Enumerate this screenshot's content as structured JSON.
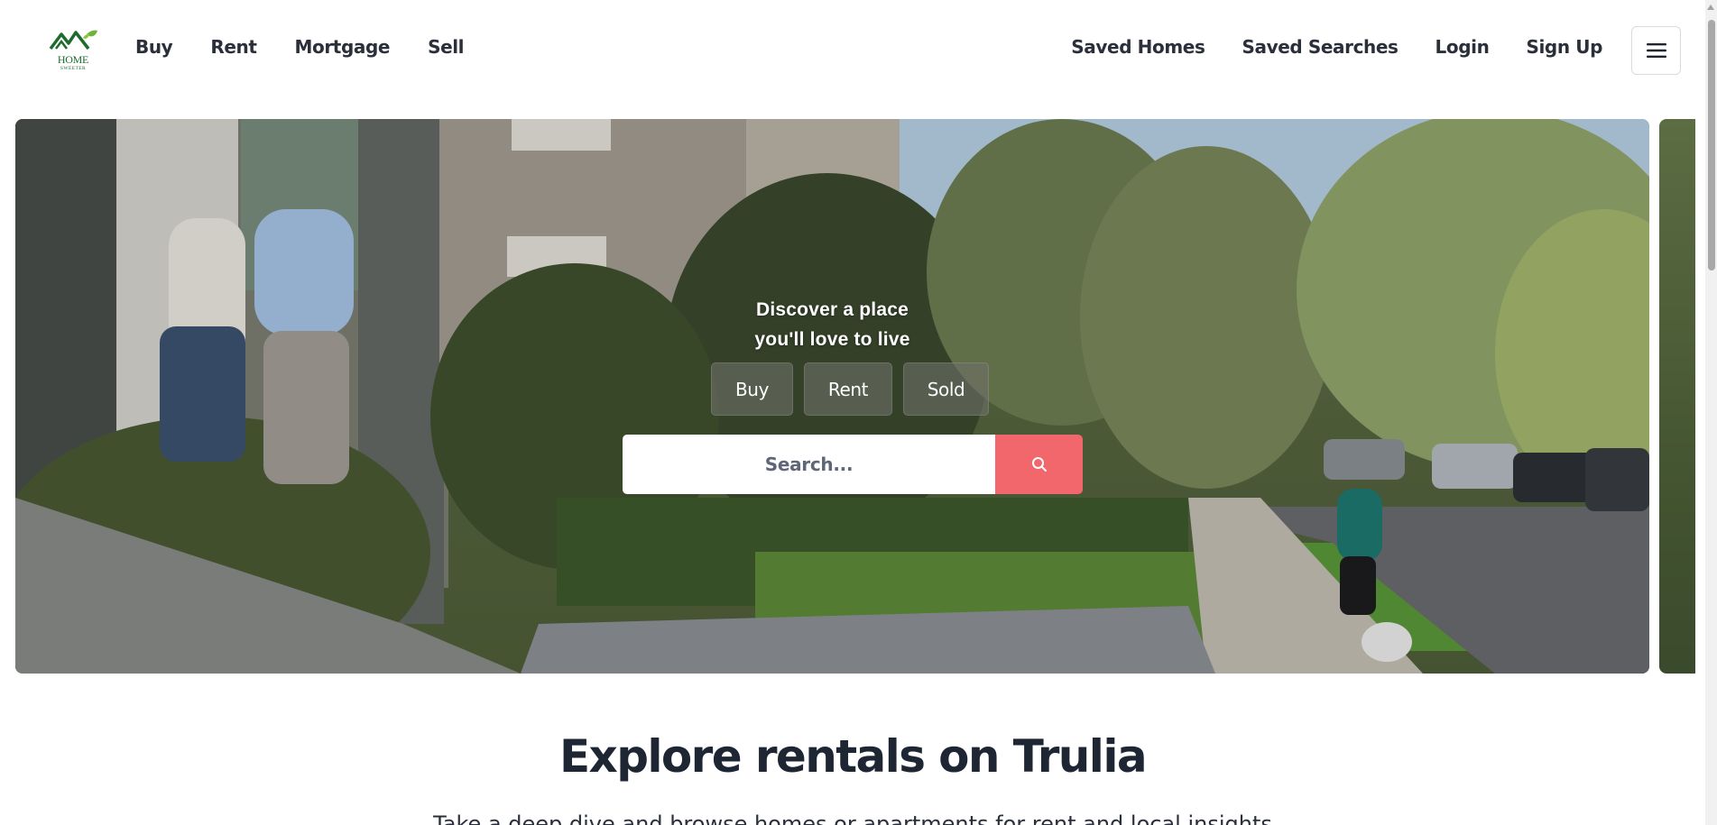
{
  "header": {
    "logo": {
      "icon": "house-leaf-logo-icon",
      "text": "HOME",
      "subtext": "SWEETER"
    },
    "nav_left": [
      "Buy",
      "Rent",
      "Mortgage",
      "Sell"
    ],
    "nav_right": [
      "Saved Homes",
      "Saved Searches",
      "Login",
      "Sign Up"
    ],
    "menu_icon": "hamburger-menu-icon"
  },
  "hero": {
    "title_line1": "Discover a place",
    "title_line2": "you'll love to live",
    "tabs": [
      "Buy",
      "Rent",
      "Sold"
    ],
    "search": {
      "placeholder": "Search...",
      "button_icon": "search-icon"
    },
    "image": "neighborhood-street-photo"
  },
  "explore": {
    "title": "Explore rentals on Trulia",
    "subtitle": "Take a deep dive and browse homes or apartments for rent and local insights"
  },
  "colors": {
    "accent": "#f2676c",
    "text_dark": "#1e2533",
    "logo_green": "#1f6b2d"
  }
}
